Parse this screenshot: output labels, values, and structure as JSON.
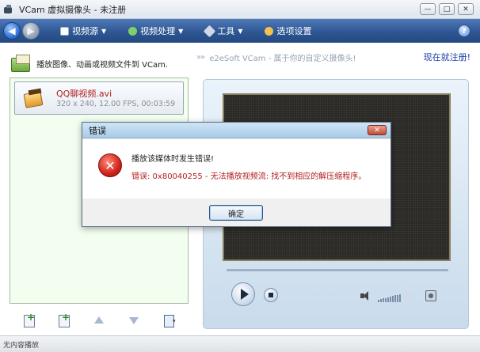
{
  "window": {
    "title": "VCam 虚拟摄像头 - 未注册",
    "minimize": "—",
    "maximize": "□",
    "close": "✕"
  },
  "toolbar": {
    "menus": [
      {
        "label": "视频源",
        "icon": "video-source-icon",
        "color": "#ffffff"
      },
      {
        "label": "视频处理",
        "icon": "video-process-icon",
        "color": "#7fd06a"
      },
      {
        "label": "工具",
        "icon": "tools-icon",
        "color": "#cfd8e6"
      },
      {
        "label": "选项设置",
        "icon": "settings-icon",
        "color": "#f2c14e"
      }
    ],
    "help": "?"
  },
  "left": {
    "header": "播放图像、动画或视频文件到 VCam.",
    "file": {
      "name": "QQ聊视频.avi",
      "meta": "320 x 240, 12.00 FPS, 00:03:59"
    }
  },
  "right": {
    "banner": "e2eSoft VCam - 属于你的自定义摄像头!",
    "register_link": "现在就注册!",
    "volume_level": 0.7
  },
  "status": {
    "text": "无内容播放"
  },
  "dialog": {
    "title": "错误",
    "close": "✕",
    "message": "播放该媒体时发生错误!",
    "detail": "错误: 0x80040255 - 无法播放视频流: 找不到相应的解压缩程序。",
    "ok_label": "确定"
  }
}
